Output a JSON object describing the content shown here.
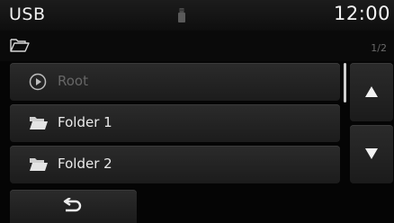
{
  "status": {
    "source": "USB",
    "clock": "12:00",
    "device_icon": "usb-drive-icon"
  },
  "path": {
    "folder_icon": "open-folder-icon",
    "page_indicator": "1/2"
  },
  "list": {
    "items": [
      {
        "label": "Root",
        "icon": "play-circle-icon",
        "enabled": false
      },
      {
        "label": "Folder 1",
        "icon": "folder-icon",
        "enabled": true
      },
      {
        "label": "Folder 2",
        "icon": "folder-icon",
        "enabled": true
      }
    ]
  },
  "controls": {
    "scroll_up_icon": "triangle-up-icon",
    "scroll_down_icon": "triangle-down-icon",
    "back_icon": "back-arrow-icon"
  },
  "colors": {
    "background": "#050505",
    "text": "#eaeaea",
    "disabled_text": "#666666",
    "button": "#2b2b2b"
  }
}
